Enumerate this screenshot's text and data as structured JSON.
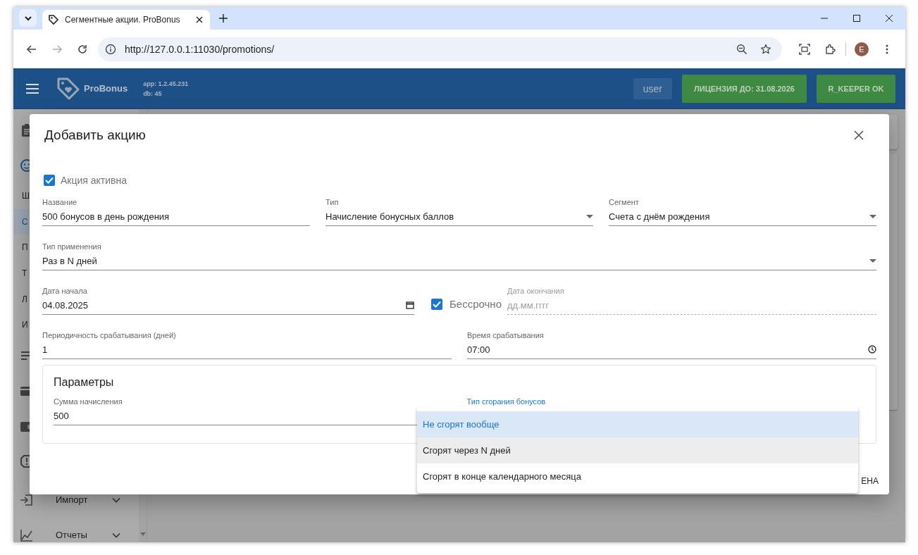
{
  "browser": {
    "tab_title": "Сегментные акции. ProBonus",
    "url": "http://127.0.0.1:11030/promotions/",
    "profile_initial": "E"
  },
  "app_header": {
    "brand": "ProBonus",
    "app_version": "app: 1.2.45.231",
    "db_version": "db: 45",
    "user": "user",
    "license": "ЛИЦЕНЗИЯ ДО: 31.08.2026",
    "rkeeper": "R_KEEPER OK"
  },
  "sidebar": {
    "items": [
      {
        "kind": "icon"
      },
      {
        "kind": "icon",
        "children": [
          {
            "label": "Ш",
            "selected": false
          },
          {
            "label": "С",
            "selected": true
          },
          {
            "label": "П",
            "selected": false
          },
          {
            "label": "Т",
            "selected": false
          },
          {
            "label": "Л",
            "selected": false
          },
          {
            "label": "И",
            "selected": false
          }
        ]
      },
      {
        "kind": "icon"
      },
      {
        "kind": "icon"
      },
      {
        "kind": "icon"
      },
      {
        "kind": "icon"
      },
      {
        "kind": "labeled",
        "label": "Импорт"
      },
      {
        "kind": "labeled",
        "label": "Отчеты"
      }
    ]
  },
  "dialog": {
    "title": "Добавить акцию",
    "active": {
      "label": "Акция активна",
      "checked": true
    },
    "rows": [
      [
        {
          "kind": "text",
          "label": "Название",
          "value": "500 бонусов в день рождения"
        },
        {
          "kind": "select",
          "label": "Тип",
          "value": "Начисление бонусных баллов"
        },
        {
          "kind": "select",
          "label": "Сегмент",
          "value": "Счета с днём рождения"
        }
      ],
      [
        {
          "kind": "select",
          "label": "Тип применения",
          "value": "Раз в N дней"
        }
      ],
      [
        {
          "kind": "date",
          "label": "Дата начала",
          "value": "04.08.2025"
        },
        {
          "kind": "checkbox",
          "label": "Бессрочно",
          "checked": true
        },
        {
          "kind": "date",
          "label": "Дата окончания",
          "placeholder": "дд.мм.гггг",
          "disabled": true
        }
      ],
      [
        {
          "kind": "text",
          "label": "Периодичность срабатывания (дней)",
          "value": "1"
        },
        {
          "kind": "time",
          "label": "Время срабатывания",
          "value": "07:00"
        }
      ]
    ],
    "parameters": {
      "title": "Параметры",
      "fields": [
        {
          "label": "Сумма начисления",
          "value": "500"
        },
        {
          "label": "Тип сгорания бонусов",
          "focused": true
        }
      ]
    },
    "footer_button": "ЕНА",
    "menu": [
      {
        "label": "Не сгорят вообще",
        "selected": true,
        "hovered": false
      },
      {
        "label": "Сгорят через N дней",
        "selected": false,
        "hovered": true
      },
      {
        "label": "Сгорят в конце календарного месяца",
        "selected": false,
        "hovered": false
      }
    ]
  }
}
